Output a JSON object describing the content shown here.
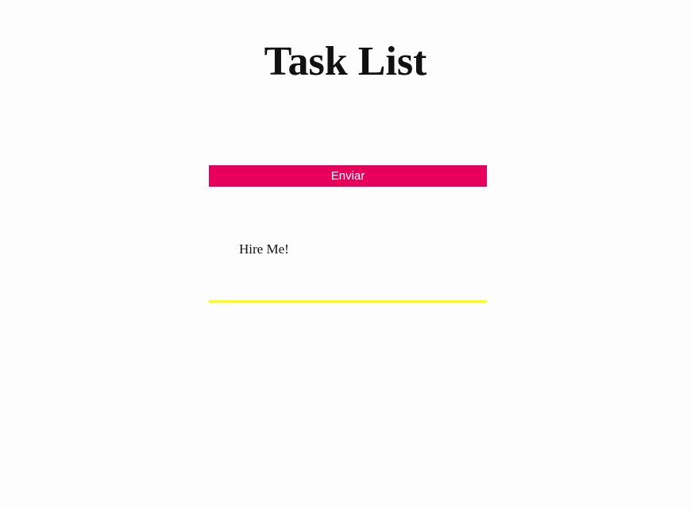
{
  "header": {
    "title": "Task List"
  },
  "form": {
    "submit_label": "Enviar"
  },
  "tasks": [
    {
      "text": "Hire Me!"
    }
  ],
  "colors": {
    "background": "#fdfdfd",
    "submit_button": "#e6005c",
    "task_divider": "#ffff00",
    "text": "#111111"
  }
}
